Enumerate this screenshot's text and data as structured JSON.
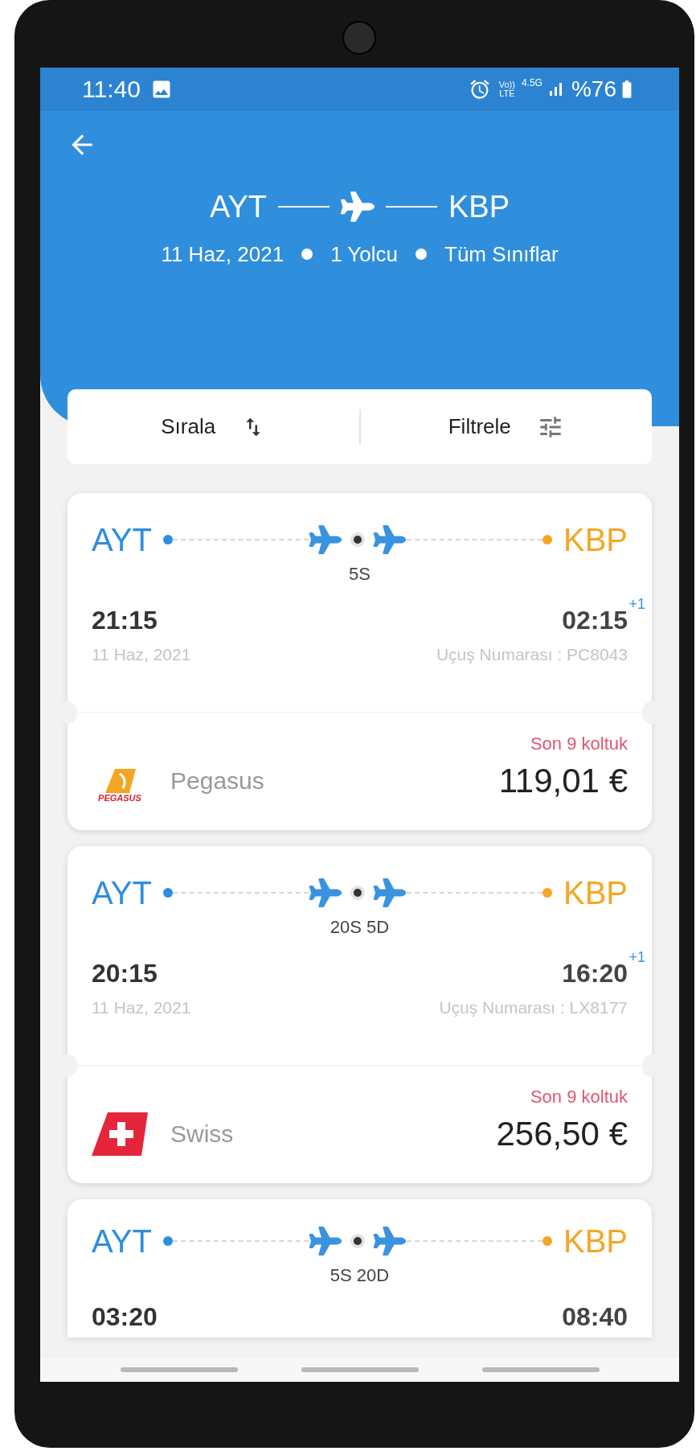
{
  "status_bar": {
    "time": "11:40",
    "volte": [
      "Vo))",
      "LTE"
    ],
    "network": "4.5G",
    "battery": "%76"
  },
  "header": {
    "origin": "AYT",
    "destination": "KBP",
    "details": [
      "11 Haz, 2021",
      "1 Yolcu",
      "Tüm Sınıflar"
    ]
  },
  "toolbar": [
    {
      "label": "Sırala",
      "kind": "sort"
    },
    {
      "label": "Filtrele",
      "kind": "filter"
    }
  ],
  "flights": [
    {
      "origin": "AYT",
      "destination": "KBP",
      "layover": "5S",
      "departure": "21:15",
      "arrival": "02:15",
      "day_offset": "+1",
      "date": "11 Haz, 2021",
      "flight_number": "Uçuş Numarası : PC8043",
      "seats": "Son 9 koltuk",
      "kind": "pegasus",
      "logo_text": "PEGASUS",
      "airline": "Pegasus",
      "price": "119,01 €"
    },
    {
      "origin": "AYT",
      "destination": "KBP",
      "layover": "20S 5D",
      "departure": "20:15",
      "arrival": "16:20",
      "day_offset": "+1",
      "date": "11 Haz, 2021",
      "flight_number": "Uçuş Numarası : LX8177",
      "seats": "Son 9 koltuk",
      "kind": "swiss",
      "airline": "Swiss",
      "price": "256,50 €"
    },
    {
      "origin": "AYT",
      "destination": "KBP",
      "layover": "5S 20D",
      "departure": "03:20",
      "arrival": "08:40"
    }
  ]
}
